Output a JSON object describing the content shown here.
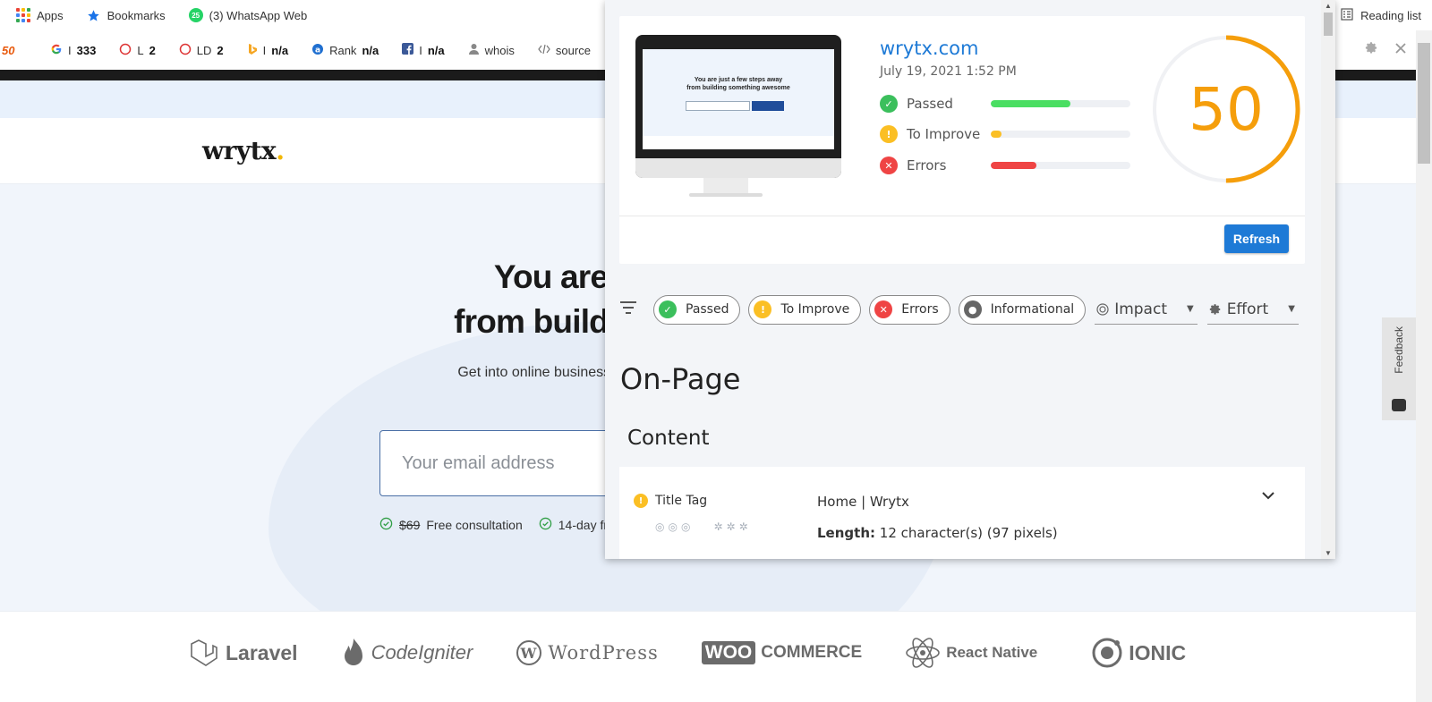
{
  "bookmarks": {
    "apps": "Apps",
    "bookmarks": "Bookmarks",
    "whatsapp_badge": "25",
    "whatsapp": "(3) WhatsApp Web",
    "reading_list": "Reading list"
  },
  "seo_toolbar": {
    "logo": "50",
    "items": [
      {
        "icon": "google-icon",
        "label": "I",
        "value": "333"
      },
      {
        "icon": "link-circle-icon",
        "label": "L",
        "value": "2"
      },
      {
        "icon": "link-circle-icon",
        "label": "LD",
        "value": "2"
      },
      {
        "icon": "bing-icon",
        "label": "I",
        "value": "n/a"
      },
      {
        "icon": "alexa-icon",
        "label": "Rank",
        "value": "n/a"
      },
      {
        "icon": "facebook-icon",
        "label": "I",
        "value": "n/a"
      },
      {
        "icon": "user-icon",
        "label": "whois",
        "value": ""
      },
      {
        "icon": "code-icon",
        "label": "source",
        "value": ""
      }
    ]
  },
  "site": {
    "logo": "wrytx",
    "logo_dot": ".",
    "hero_line1": "You are just a few steps away",
    "hero_line2": "from building something awesome",
    "hero_sub": "Get into online business. Sell online, manage anything and everything, anywhere.",
    "email_placeholder": "Your email address",
    "perk1_price": "$69",
    "perk1": "Free consultation",
    "perk2": "14-day free trial",
    "techs": [
      "Laravel",
      "CodeIgniter",
      "WordPress",
      "WOO",
      "COMMERCE",
      "React Native",
      "IONIC"
    ],
    "feedback": "Feedback"
  },
  "popup": {
    "site_name": "wrytx.com",
    "date": "July 19, 2021 1:52 PM",
    "score": "50",
    "score_fraction": 0.5,
    "metrics": [
      {
        "label": "Passed",
        "fraction": 0.57,
        "color": "#4ade62"
      },
      {
        "label": "To Improve",
        "fraction": 0.08,
        "color": "#fbbf24"
      },
      {
        "label": "Errors",
        "fraction": 0.33,
        "color": "#ef4444"
      }
    ],
    "refresh": "Refresh",
    "screen_title_1": "You are just a few steps away",
    "screen_title_2": "from building something awesome",
    "filters": {
      "passed": "Passed",
      "to_improve": "To Improve",
      "errors": "Errors",
      "informational": "Informational",
      "impact": "Impact",
      "effort": "Effort"
    },
    "section": "On-Page",
    "subsection": "Content",
    "row": {
      "name": "Title Tag",
      "value": "Home | Wrytx",
      "length_label": "Length:",
      "length_value": "12 character(s) (97 pixels)"
    }
  },
  "colors": {
    "accent": "#1e7ad6",
    "score": "#f59e0b",
    "passed": "#4ade62",
    "improve": "#fbbf24",
    "error": "#ef4444"
  }
}
